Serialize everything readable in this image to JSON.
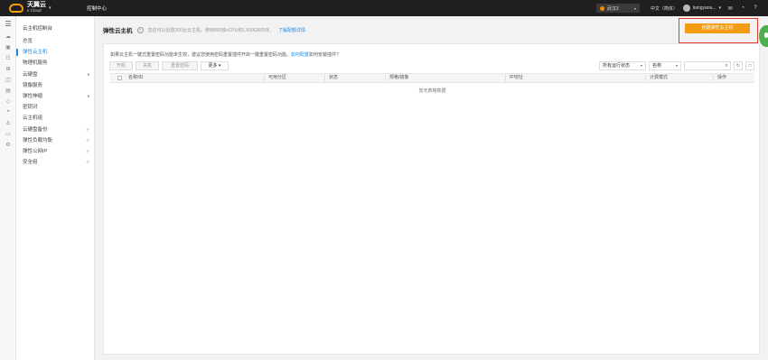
{
  "topbar": {
    "logo_cn": "天翼云",
    "logo_en": "e Cloud",
    "console": "控制中心",
    "region": "武汉3",
    "language": "中文（简体）",
    "username": "liangyana...",
    "icons": [
      "mail-icon",
      "rss-icon",
      "help-icon"
    ]
  },
  "sidebar": {
    "title": "云主机控制台",
    "items": [
      {
        "label": "总览"
      },
      {
        "label": "弹性云主机",
        "active": true
      },
      {
        "label": "物理机服务"
      },
      {
        "label": "云硬盘",
        "caret": true
      },
      {
        "label": "镜像服务"
      },
      {
        "label": "弹性伸缩",
        "caret": true
      },
      {
        "label": "密钥对"
      },
      {
        "label": "云主机组"
      },
      {
        "label": "云硬盘备份",
        "external": true
      },
      {
        "label": "弹性负载均衡",
        "external": true
      },
      {
        "label": "弹性公网IP",
        "external": true
      },
      {
        "label": "安全组",
        "external": true
      }
    ]
  },
  "page": {
    "title": "弹性云主机",
    "quota": "您还可以创建200台云主机，使用800核vCPU和1,600GB内存。",
    "quota_link": "了解配额详情",
    "create_button": "创建弹性云主机"
  },
  "notice": {
    "text": "如果云主机一键式重置密码功能未生效，建议您使用密码重置插件开启一键重置密码功能。",
    "link": "如何配置",
    "suffix": "如何安装插件?"
  },
  "toolbar": {
    "buttons": [
      "开机",
      "关机",
      "重置密码"
    ],
    "more": "更多"
  },
  "filter": {
    "status": "所有运行状态",
    "field": "名称"
  },
  "table": {
    "columns": [
      "名称/ID",
      "可用分区",
      "状态",
      "规格/镜像",
      "IP地址",
      "计费模式",
      "操作"
    ],
    "empty": "暂无表格数据"
  }
}
